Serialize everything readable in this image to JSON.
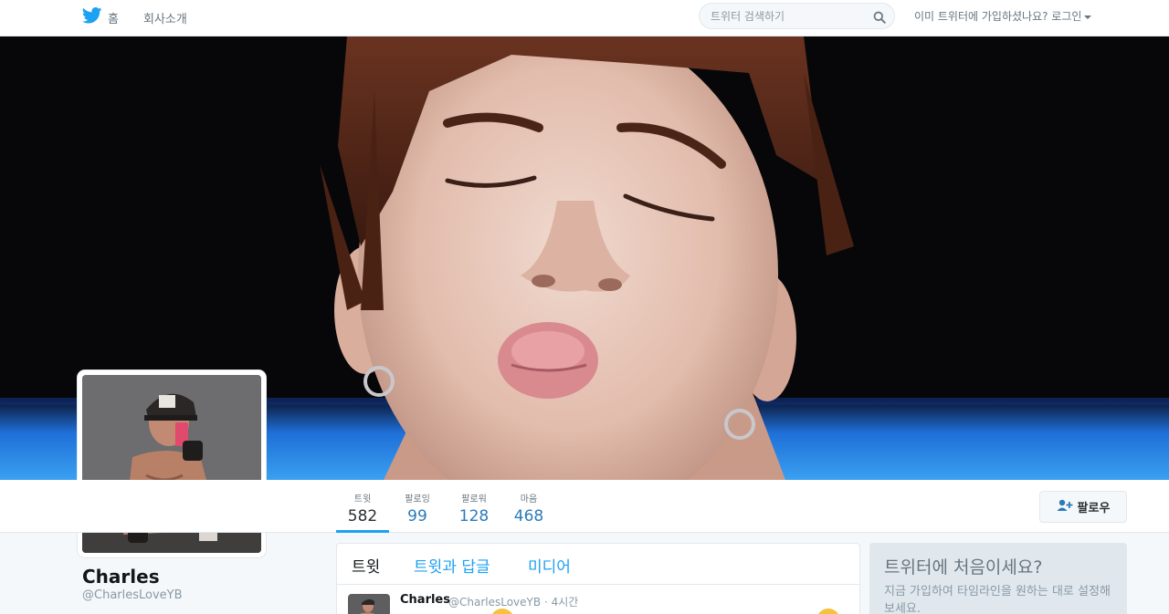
{
  "topbar": {
    "home_label": "홈",
    "about_label": "회사소개",
    "search_placeholder": "트위터 검색하기",
    "login_prompt": "이미 트위터에 가입하셨나요? 로그인"
  },
  "icons": {
    "brand": "twitter-bird-icon",
    "search": "search-icon",
    "follow": "add-user-icon",
    "dropdown": "caret-down-icon"
  },
  "colors": {
    "brand": "#1da1f2",
    "link": "#2b7bb9",
    "text": "#292f33",
    "muted": "#8899a6"
  },
  "profile": {
    "name": "Charles",
    "handle": "@CharlesLoveYB"
  },
  "stats": [
    {
      "label": "트윗",
      "value": "582"
    },
    {
      "label": "팔로잉",
      "value": "99"
    },
    {
      "label": "팔로워",
      "value": "128"
    },
    {
      "label": "마음",
      "value": "468"
    }
  ],
  "follow_button": {
    "label": "팔로우"
  },
  "timeline": {
    "tabs": [
      "트윗",
      "트윗과 답글",
      "미디어"
    ],
    "first_tweet": {
      "name": "Charles",
      "handle": "@CharlesLoveYB",
      "time": "· 4시간"
    }
  },
  "sidebar": {
    "title": "트위터에 처음이세요?",
    "body": "지금 가입하여 타임라인을 원하는 대로 설정해 보세요."
  }
}
